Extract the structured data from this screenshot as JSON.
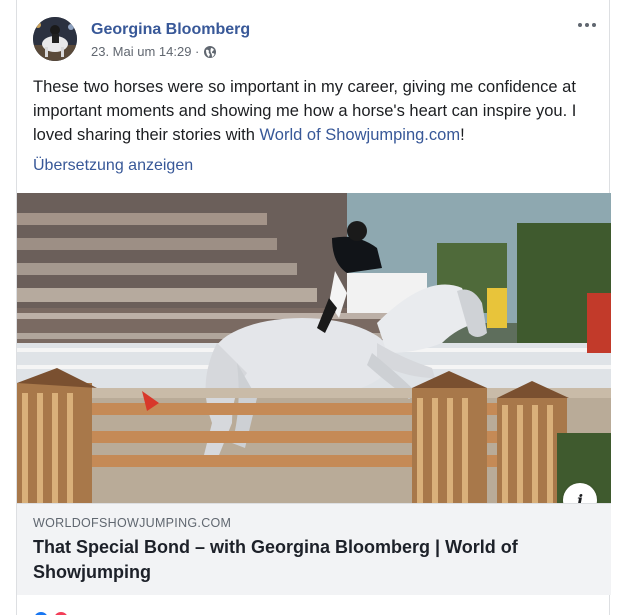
{
  "post": {
    "author": "Georgina Bloomberg",
    "timestamp": "23. Mai um 14:29 · ",
    "privacy_icon": "globe-icon",
    "text_before_link": "These two horses were so important in my career, giving me confidence at important moments and showing me how a horse's heart can inspire you. I loved sharing their stories with ",
    "link_text": "World of Showjumping.com",
    "text_after_link": "!",
    "translate_label": "Übersetzung anzeigen"
  },
  "link_preview": {
    "domain": "WORLDOFSHOWJUMPING.COM",
    "title": "That Special Bond – with Georgina Bloomberg | World of Showjumping",
    "info_glyph": "i"
  },
  "colors": {
    "link_blue": "#385898",
    "secondary_text": "#606770",
    "preview_bg": "#f2f3f5",
    "like_blue": "#1877f2",
    "love_red": "#f33e58"
  }
}
